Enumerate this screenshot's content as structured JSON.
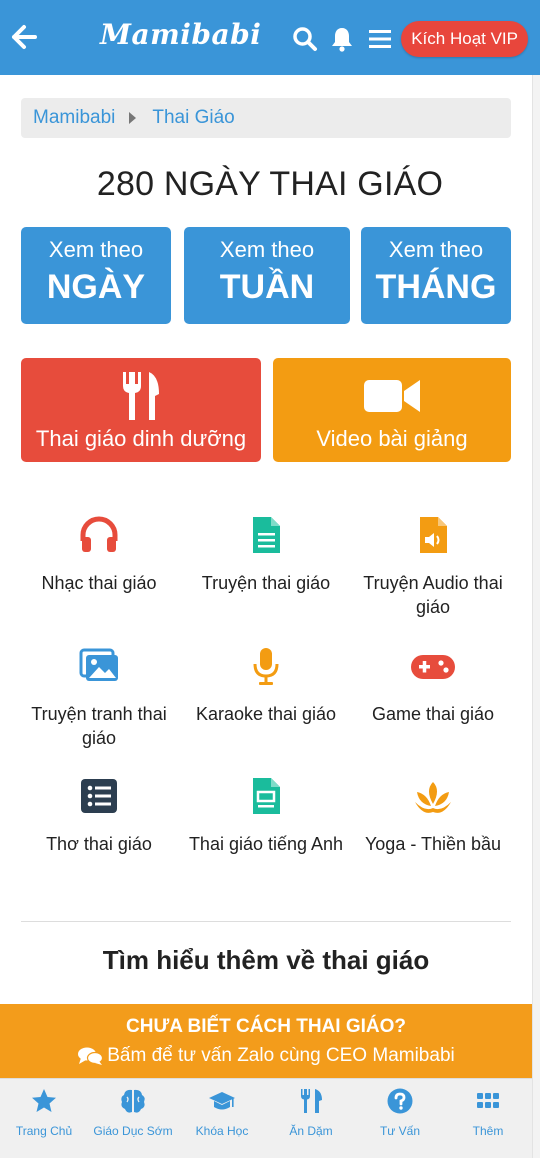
{
  "header": {
    "logo": "Mamibabi",
    "vip_label": "Kích Hoạt VIP"
  },
  "breadcrumb": {
    "home": "Mamibabi",
    "current": "Thai Giáo"
  },
  "page_title": "280 NGÀY THAI GIÁO",
  "view_buttons": [
    {
      "line1": "Xem theo",
      "line2": "NGÀY"
    },
    {
      "line1": "Xem theo",
      "line2": "TUẦN"
    },
    {
      "line1": "Xem theo",
      "line2": "THÁNG"
    }
  ],
  "feature_buttons": {
    "nutrition": {
      "label": "Thai giáo dinh dưỡng",
      "color": "#e74c3c",
      "icon": "fork-knife-icon"
    },
    "video": {
      "label": "Video bài giảng",
      "color": "#f39c12",
      "icon": "video-camera-icon"
    }
  },
  "grid": [
    {
      "label": "Nhạc thai giáo",
      "icon": "headphones-icon",
      "color": "#e74c3c"
    },
    {
      "label": "Truyện thai giáo",
      "icon": "document-icon",
      "color": "#1abc9c"
    },
    {
      "label": "Truyện Audio thai giáo",
      "icon": "audio-file-icon",
      "color": "#f39c12"
    },
    {
      "label": "Truyện tranh thai giáo",
      "icon": "images-icon",
      "color": "#3a95d8"
    },
    {
      "label": "Karaoke thai giáo",
      "icon": "microphone-icon",
      "color": "#f39c12"
    },
    {
      "label": "Game thai giáo",
      "icon": "gamepad-icon",
      "color": "#e74c3c"
    },
    {
      "label": "Thơ thai giáo",
      "icon": "list-icon",
      "color": "#2c3e50"
    },
    {
      "label": "Thai giáo tiếng Anh",
      "icon": "newspaper-icon",
      "color": "#1abc9c"
    },
    {
      "label": "Yoga - Thiền bầu",
      "icon": "lotus-icon",
      "color": "#f39c12"
    }
  ],
  "more_heading": "Tìm hiểu thêm về thai giáo",
  "banner": {
    "line1": "CHƯA BIẾT CÁCH THAI GIÁO?",
    "line2": "Bấm để tư vấn Zalo cùng CEO Mamibabi"
  },
  "bottom_nav": [
    {
      "label": "Trang Chủ",
      "icon": "star-icon"
    },
    {
      "label": "Giáo Dục Sớm",
      "icon": "brain-icon"
    },
    {
      "label": "Khóa Học",
      "icon": "graduation-cap-icon"
    },
    {
      "label": "Ăn Dặm",
      "icon": "utensils-icon"
    },
    {
      "label": "Tư Vấn",
      "icon": "question-icon"
    },
    {
      "label": "Thêm",
      "icon": "grid-icon"
    }
  ],
  "colors": {
    "primary": "#3a95d8",
    "red": "#e74c3c",
    "orange": "#f39c12"
  }
}
